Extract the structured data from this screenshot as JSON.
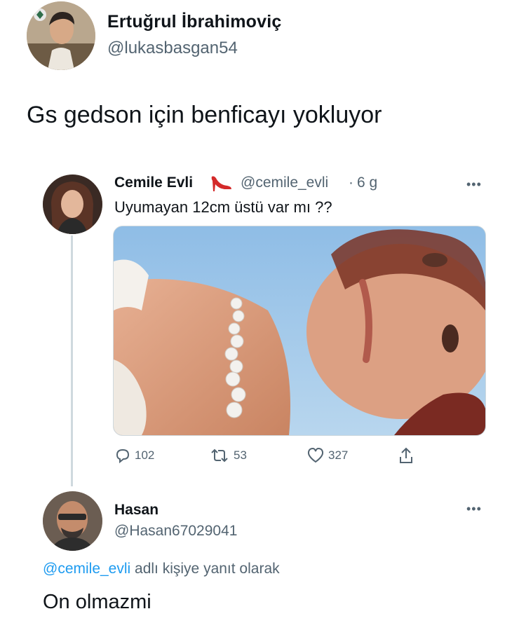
{
  "outer_tweet": {
    "author_name": "Ertuğrul İbrahimoviç",
    "author_handle": "@lukasbasgan54",
    "text": "Gs gedson için benficayı yokluyor"
  },
  "quoted_tweet": {
    "author_name": "Cemile Evli",
    "name_emoji_icon": "high-heel-shoe-icon",
    "author_handle": "@cemile_evli",
    "separator": "·",
    "time": "6 g",
    "text": "Uyumayan 12cm üstü var mı ??",
    "more_icon": "more-dots-icon",
    "actions": {
      "reply_count": "102",
      "retweet_count": "53",
      "like_count": "327"
    }
  },
  "reply_tweet": {
    "author_name": "Hasan",
    "author_handle": "@Hasan67029041",
    "replying_mention": "@cemile_evli",
    "replying_suffix": " adlı kişiye yanıt olarak",
    "text": "On olmazmi"
  },
  "colors": {
    "text_primary": "#0f1419",
    "text_secondary": "#536471",
    "link": "#1d9bf0",
    "divider": "#cfd9de"
  }
}
